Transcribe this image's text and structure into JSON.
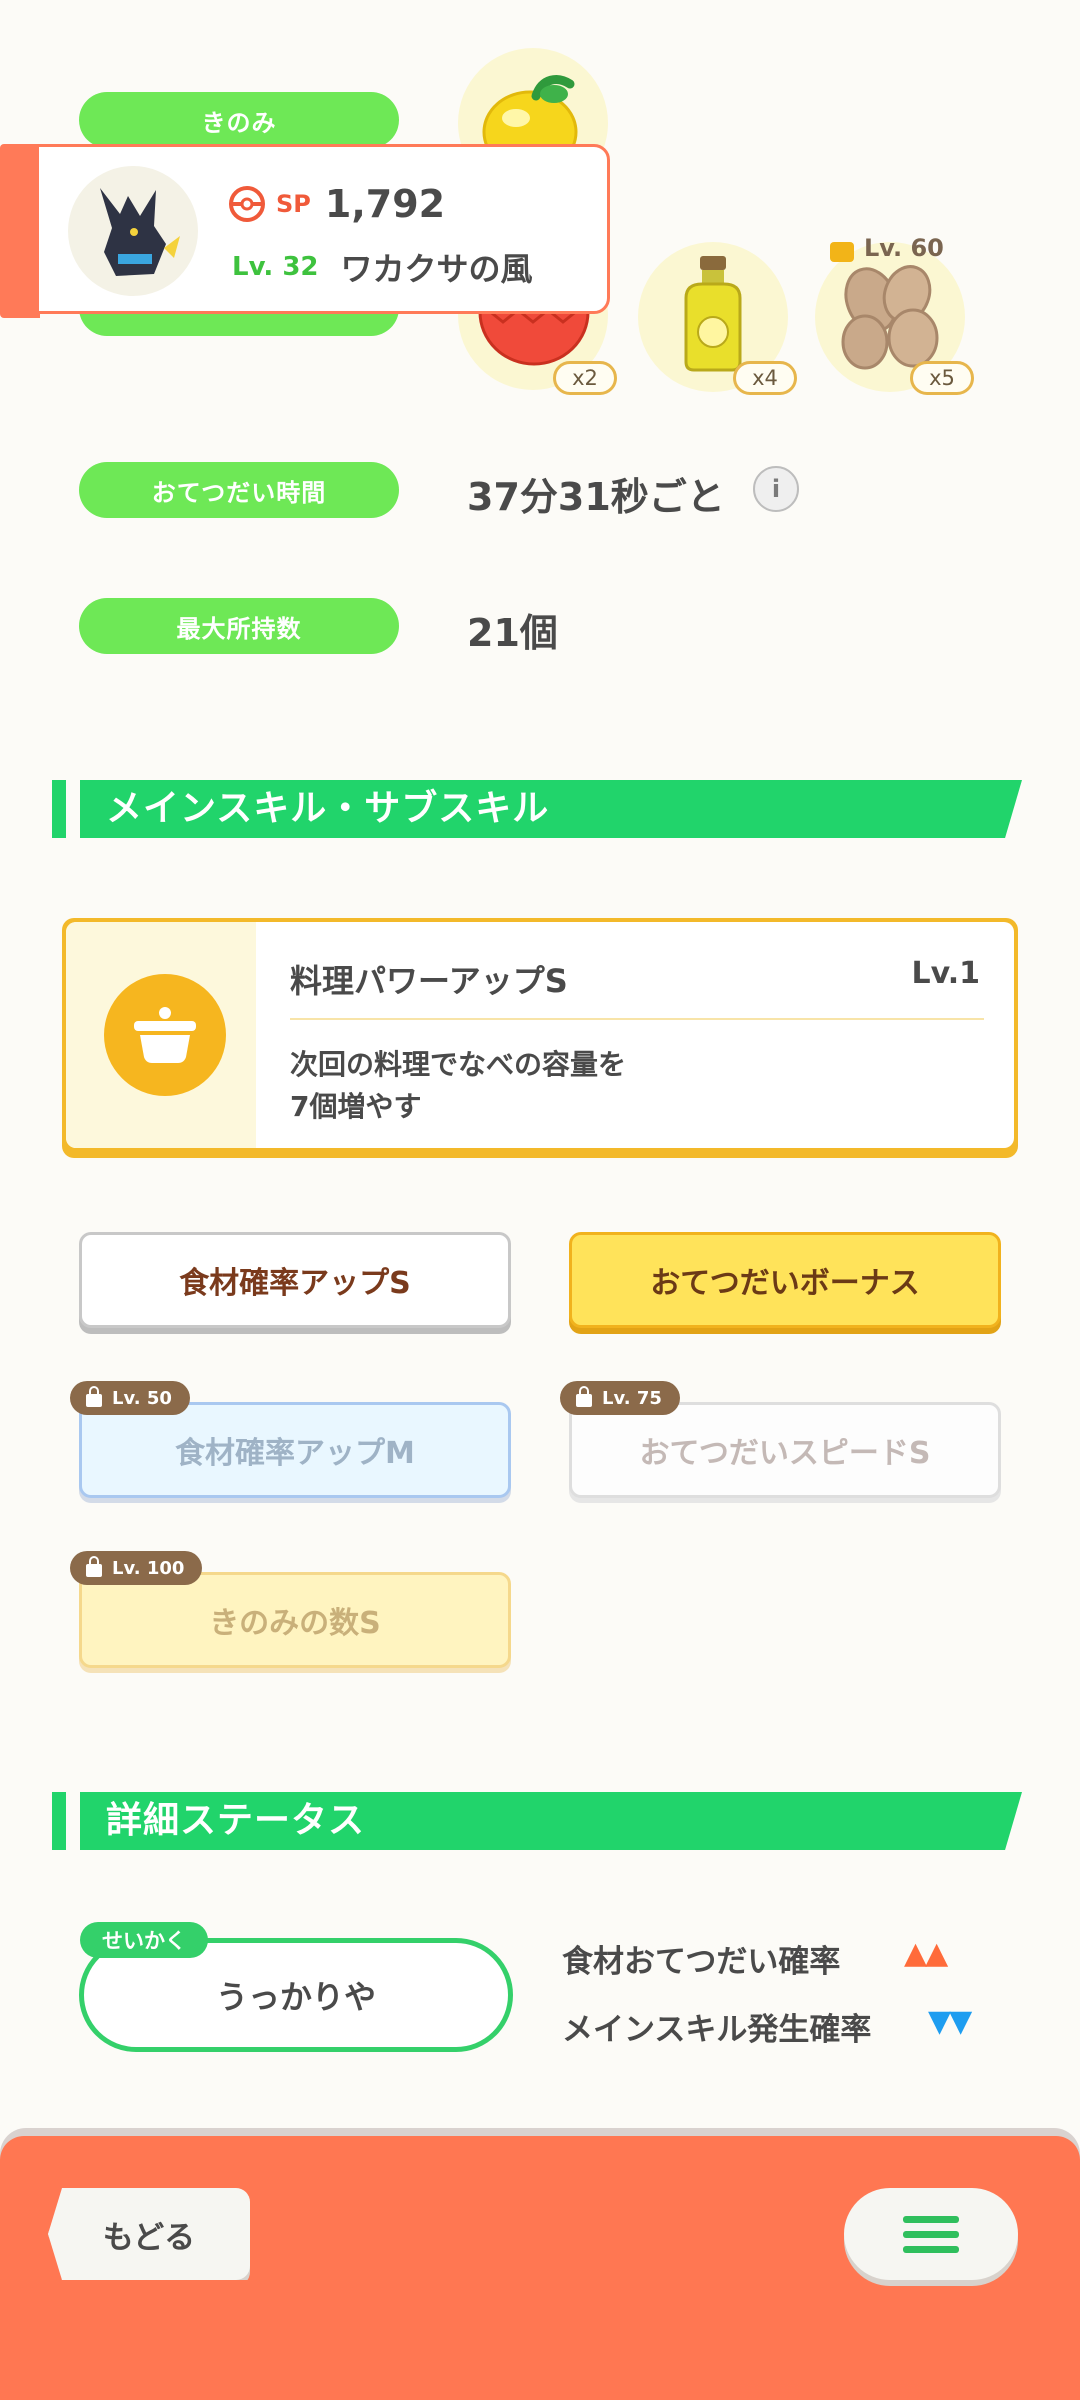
{
  "labels": {
    "berry": "きのみ",
    "help_time": "おてつだい時間",
    "max_carry": "最大所持数"
  },
  "help_time_value": "37分31秒ごと",
  "max_carry_value": "21個",
  "pokemon_card": {
    "sp_label": "SP",
    "sp_value": "1,792",
    "level": "Lv. 32",
    "name": "ワカクサの風"
  },
  "ingredients": {
    "counts": [
      "x2",
      "x4",
      "x5"
    ],
    "locked_level": "Lv. 60"
  },
  "main_skill_section": {
    "title": "メインスキル・サブスキル",
    "skill_name": "料理パワーアップS",
    "skill_level": "Lv.1",
    "skill_desc_line1": "次回の料理でなべの容量を",
    "skill_desc_line2": "7個増やす"
  },
  "sub_skills": [
    {
      "label": "食材確率アップS"
    },
    {
      "label": "おてつだいボーナス"
    },
    {
      "label": "食材確率アップM",
      "lock": "Lv. 50"
    },
    {
      "label": "おてつだいスピードS",
      "lock": "Lv. 75"
    },
    {
      "label": "きのみの数S",
      "lock": "Lv. 100"
    }
  ],
  "detail_section": {
    "title": "詳細ステータス",
    "nature_tag": "せいかく",
    "nature": "うっかりや",
    "stat_up": "食材おてつだい確率",
    "stat_down": "メインスキル発生確率",
    "up_arrows": "▲▲",
    "down_arrows": "▼▼"
  },
  "bottom_bar": {
    "back_label": "もどる",
    "menu_icon": "hamburger-menu-icon"
  },
  "colors": {
    "green_pill": "#6ee856",
    "section_green": "#21d46b",
    "bottom_bar": "#ff7752",
    "up": "#ff6b3a",
    "down": "#1e9df0"
  }
}
